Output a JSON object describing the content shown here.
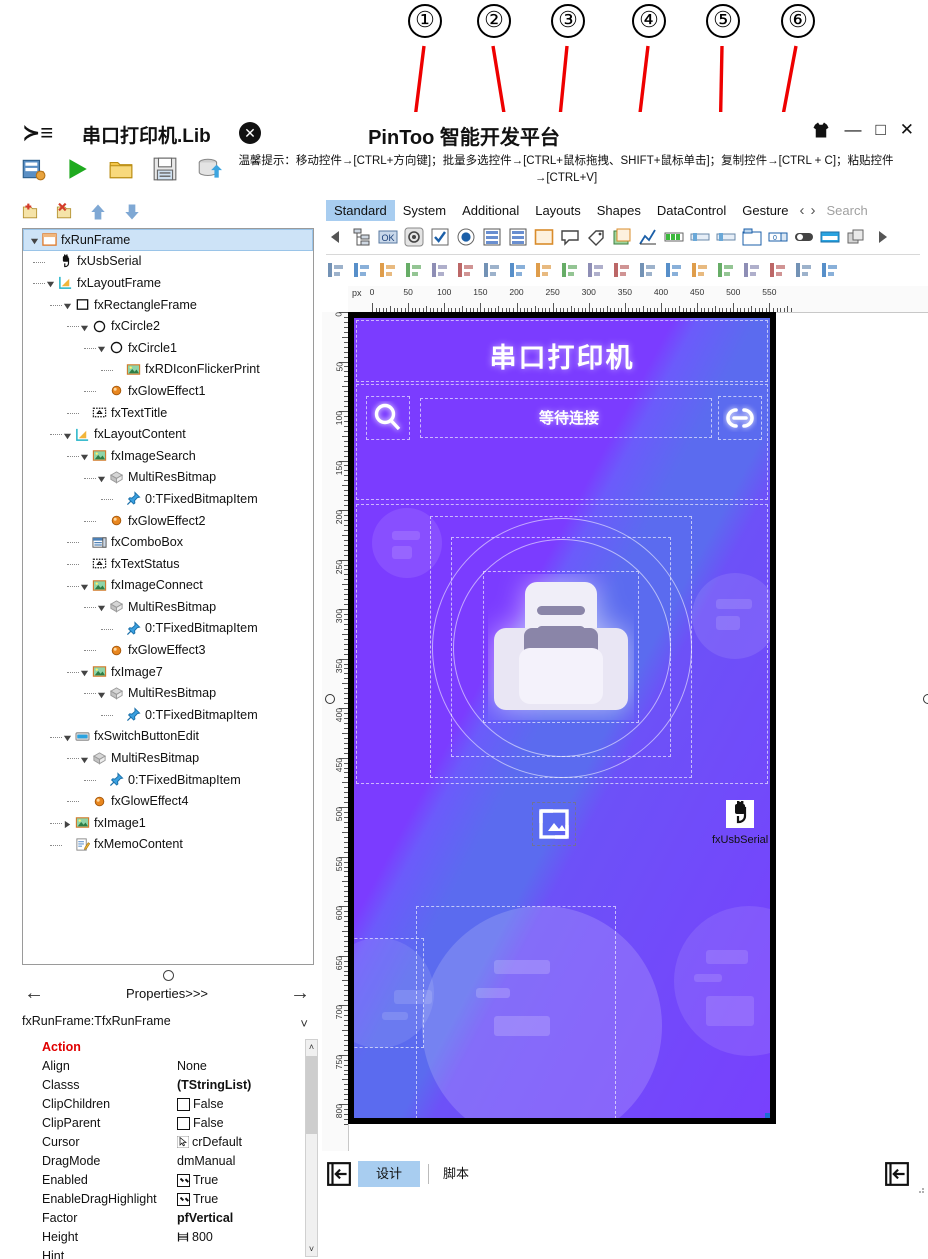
{
  "callouts": {
    "numbers": [
      "①",
      "②",
      "③",
      "④",
      "⑤",
      "⑥"
    ]
  },
  "titlebar": {
    "menu_icon": "hamburger-icon",
    "project_name": "串口打印机.Lib",
    "close_doc_label": "✕",
    "app_title": "PinToo 智能开发平台",
    "shirt_icon": "theme-shirt-icon",
    "minimize": "—",
    "maximize": "□",
    "close": "✕"
  },
  "toolbar": {
    "icons": [
      "new-project-icon",
      "run-icon",
      "open-folder-icon",
      "save-icon",
      "database-icon"
    ],
    "hint": "温馨提示：移动控件→[CTRL+方向键]；批量多选控件→[CTRL+鼠标拖拽、SHIFT+鼠标单击]；复制控件→[CTRL + C]；粘贴控件→[CTRL+V]"
  },
  "tree_toolbar": {
    "icons": [
      "add-node-icon",
      "delete-node-icon",
      "move-up-icon",
      "move-down-icon"
    ]
  },
  "tree": {
    "nodes": [
      {
        "label": "fxRunFrame",
        "depth": 0,
        "icon": "frame-icon",
        "expander": "down",
        "selected": true
      },
      {
        "label": "fxUsbSerial",
        "depth": 1,
        "icon": "usb-icon",
        "expander": "none",
        "selected": false
      },
      {
        "label": "fxLayoutFrame",
        "depth": 1,
        "icon": "layout-icon",
        "expander": "down",
        "selected": false
      },
      {
        "label": "fxRectangleFrame",
        "depth": 2,
        "icon": "rectangle-icon",
        "expander": "down",
        "selected": false
      },
      {
        "label": "fxCircle2",
        "depth": 3,
        "icon": "circle-icon",
        "expander": "down",
        "selected": false
      },
      {
        "label": "fxCircle1",
        "depth": 4,
        "icon": "circle-icon",
        "expander": "down",
        "selected": false
      },
      {
        "label": "fxRDIconFlickerPrint",
        "depth": 5,
        "icon": "image-icon",
        "expander": "none",
        "selected": false
      },
      {
        "label": "fxGlowEffect1",
        "depth": 4,
        "icon": "glow-icon",
        "expander": "none",
        "selected": false
      },
      {
        "label": "fxTextTitle",
        "depth": 3,
        "icon": "text-icon",
        "expander": "none",
        "selected": false
      },
      {
        "label": "fxLayoutContent",
        "depth": 2,
        "icon": "layout-icon",
        "expander": "down",
        "selected": false
      },
      {
        "label": "fxImageSearch",
        "depth": 3,
        "icon": "image-icon",
        "expander": "down",
        "selected": false
      },
      {
        "label": "MultiResBitmap",
        "depth": 4,
        "icon": "bitmap-icon",
        "expander": "down",
        "selected": false
      },
      {
        "label": "0:TFixedBitmapItem",
        "depth": 5,
        "icon": "pin-icon",
        "expander": "none",
        "selected": false
      },
      {
        "label": "fxGlowEffect2",
        "depth": 4,
        "icon": "glow-icon",
        "expander": "none",
        "selected": false
      },
      {
        "label": "fxComboBox",
        "depth": 3,
        "icon": "combobox-icon",
        "expander": "none",
        "selected": false
      },
      {
        "label": "fxTextStatus",
        "depth": 3,
        "icon": "text-icon",
        "expander": "none",
        "selected": false
      },
      {
        "label": "fxImageConnect",
        "depth": 3,
        "icon": "image-icon",
        "expander": "down",
        "selected": false
      },
      {
        "label": "MultiResBitmap",
        "depth": 4,
        "icon": "bitmap-icon",
        "expander": "down",
        "selected": false
      },
      {
        "label": "0:TFixedBitmapItem",
        "depth": 5,
        "icon": "pin-icon",
        "expander": "none",
        "selected": false
      },
      {
        "label": "fxGlowEffect3",
        "depth": 4,
        "icon": "glow-icon",
        "expander": "none",
        "selected": false
      },
      {
        "label": "fxImage7",
        "depth": 3,
        "icon": "image-icon",
        "expander": "down",
        "selected": false
      },
      {
        "label": "MultiResBitmap",
        "depth": 4,
        "icon": "bitmap-icon",
        "expander": "down",
        "selected": false
      },
      {
        "label": "0:TFixedBitmapItem",
        "depth": 5,
        "icon": "pin-icon",
        "expander": "none",
        "selected": false
      },
      {
        "label": "fxSwitchButtonEdit",
        "depth": 2,
        "icon": "switch-icon",
        "expander": "down",
        "selected": false
      },
      {
        "label": "MultiResBitmap",
        "depth": 3,
        "icon": "bitmap-icon",
        "expander": "down",
        "selected": false
      },
      {
        "label": "0:TFixedBitmapItem",
        "depth": 4,
        "icon": "pin-icon",
        "expander": "none",
        "selected": false
      },
      {
        "label": "fxGlowEffect4",
        "depth": 3,
        "icon": "glow-icon",
        "expander": "none",
        "selected": false
      },
      {
        "label": "fxImage1",
        "depth": 2,
        "icon": "image-icon",
        "expander": "right",
        "selected": false
      },
      {
        "label": "fxMemoContent",
        "depth": 2,
        "icon": "memo-icon",
        "expander": "none",
        "selected": false
      }
    ]
  },
  "properties": {
    "nav_title": "Properties>>>",
    "prev_icon": "arrow-left-icon",
    "next_icon": "arrow-right-icon",
    "object": "fxRunFrame:TfxRunFrame",
    "rows": [
      {
        "name": "Action",
        "value": "",
        "kind": "header"
      },
      {
        "name": "Align",
        "value": "None",
        "kind": "text"
      },
      {
        "name": "Classs",
        "value": "(TStringList)",
        "kind": "bold"
      },
      {
        "name": "ClipChildren",
        "value": "False",
        "kind": "checkbox-off"
      },
      {
        "name": "ClipParent",
        "value": "False",
        "kind": "checkbox-off"
      },
      {
        "name": "Cursor",
        "value": "crDefault",
        "kind": "cursor"
      },
      {
        "name": "DragMode",
        "value": "dmManual",
        "kind": "text"
      },
      {
        "name": "Enabled",
        "value": "True",
        "kind": "checkbox-on"
      },
      {
        "name": "EnableDragHighlight",
        "value": "True",
        "kind": "checkbox-on"
      },
      {
        "name": "Factor",
        "value": "pfVertical",
        "kind": "bold"
      },
      {
        "name": "Height",
        "value": "800",
        "kind": "height"
      },
      {
        "name": "Hint",
        "value": "",
        "kind": "text"
      }
    ]
  },
  "palette": {
    "tabs": [
      {
        "label": "Standard",
        "active": true
      },
      {
        "label": "System",
        "active": false
      },
      {
        "label": "Additional",
        "active": false
      },
      {
        "label": "Layouts",
        "active": false
      },
      {
        "label": "Shapes",
        "active": false
      },
      {
        "label": "DataControl",
        "active": false
      },
      {
        "label": "Gesture",
        "active": false
      }
    ],
    "nav_prev_icon": "chevron-left-icon",
    "nav_next_icon": "chevron-right-icon",
    "search_placeholder": "Search",
    "row1_icons": [
      "scroll-left-icon",
      "tree-view-icon",
      "ok-button-icon",
      "speed-button-icon",
      "checkbox-icon",
      "radio-button-icon",
      "list-box-icon",
      "list-view-icon",
      "panel-icon",
      "callout-icon",
      "label-icon",
      "group-box-icon",
      "chart-icon",
      "progress-bar-icon",
      "track-bar-icon",
      "scroll-bar-icon",
      "tab-control-icon",
      "spin-box-icon",
      "switch-icon",
      "edit-icon",
      "layers-icon",
      "scroll-right-icon"
    ],
    "row2_icons": [
      "align-left-icon",
      "align-right-icon",
      "align-top-icon",
      "align-bottom-icon",
      "center-h-icon",
      "center-v-icon",
      "space-h-icon",
      "space-eq-h-icon",
      "space-v-icon",
      "space-eq-v-icon",
      "size-h-icon",
      "size-v-icon",
      "grow-icon",
      "shrink-icon",
      "bring-front-icon",
      "send-back-icon",
      "group-icon",
      "ungroup-icon",
      "top-align-icon",
      "bottom-align-icon"
    ]
  },
  "ruler": {
    "unit": "px",
    "h_labels": [
      "0",
      "50",
      "100",
      "150",
      "200",
      "250",
      "300",
      "350",
      "400",
      "450",
      "500",
      "550"
    ],
    "v_labels": [
      "0",
      "50",
      "100",
      "150",
      "200",
      "250",
      "300",
      "350",
      "400",
      "450",
      "500",
      "550",
      "600",
      "650",
      "700",
      "750",
      "800"
    ]
  },
  "design": {
    "screen_title": "串口打印机",
    "status_text": "等待连接",
    "search_icon": "magnifier-icon",
    "connect_icon": "link-connect-icon",
    "printer_icon": "printer-icon",
    "image7_icon": "image-placeholder-icon",
    "usb_component_label": "fxUsbSerial",
    "usb_component_icon": "usb-plug-icon",
    "colors": {
      "purple": "#7B3CFF",
      "blue": "#5B6BEF",
      "frame": "#000000",
      "selection_handle": "#1a6fd4"
    }
  },
  "bottombar": {
    "left_icon": "collapse-left-icon",
    "tabs": [
      {
        "label": "设计",
        "active": true
      },
      {
        "label": "脚本",
        "active": false
      }
    ],
    "right_icon": "collapse-right-icon"
  }
}
